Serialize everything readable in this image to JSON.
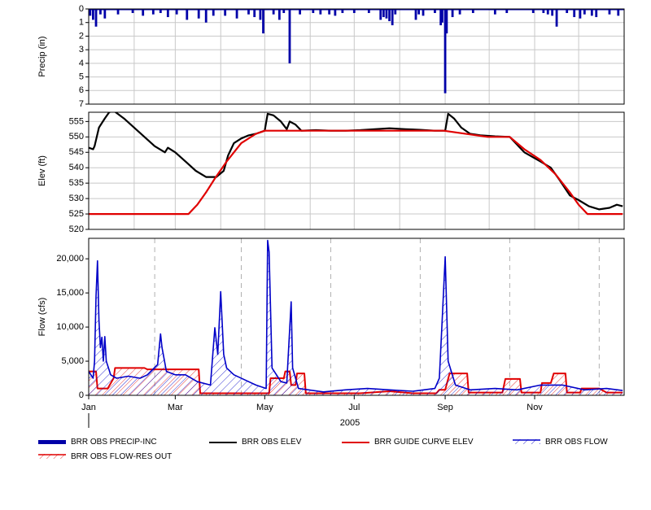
{
  "chart_data": [
    {
      "type": "bar",
      "ylabel": "Precip (in)",
      "ylim": [
        7,
        0
      ],
      "yticks": [
        "0",
        "1",
        "2",
        "3",
        "4",
        "5",
        "6",
        "7"
      ],
      "color": "#0000a8",
      "events": [
        {
          "x": "01-02",
          "y": 0.5
        },
        {
          "x": "01-04",
          "y": 0.8
        },
        {
          "x": "01-06",
          "y": 1.3
        },
        {
          "x": "01-09",
          "y": 0.4
        },
        {
          "x": "01-12",
          "y": 0.7
        },
        {
          "x": "01-21",
          "y": 0.4
        },
        {
          "x": "01-31",
          "y": 0.3
        },
        {
          "x": "02-07",
          "y": 0.5
        },
        {
          "x": "02-14",
          "y": 0.4
        },
        {
          "x": "02-19",
          "y": 0.3
        },
        {
          "x": "02-24",
          "y": 0.6
        },
        {
          "x": "03-02",
          "y": 0.4
        },
        {
          "x": "03-09",
          "y": 0.8
        },
        {
          "x": "03-17",
          "y": 0.7
        },
        {
          "x": "03-22",
          "y": 1.0
        },
        {
          "x": "03-27",
          "y": 0.5
        },
        {
          "x": "04-04",
          "y": 0.5
        },
        {
          "x": "04-12",
          "y": 0.7
        },
        {
          "x": "04-20",
          "y": 0.4
        },
        {
          "x": "04-24",
          "y": 0.6
        },
        {
          "x": "04-28",
          "y": 0.8
        },
        {
          "x": "04-30",
          "y": 1.8
        },
        {
          "x": "05-07",
          "y": 0.4
        },
        {
          "x": "05-11",
          "y": 0.8
        },
        {
          "x": "05-14",
          "y": 0.3
        },
        {
          "x": "05-18",
          "y": 4.0
        },
        {
          "x": "05-25",
          "y": 0.4
        },
        {
          "x": "06-03",
          "y": 0.3
        },
        {
          "x": "06-08",
          "y": 0.4
        },
        {
          "x": "06-14",
          "y": 0.4
        },
        {
          "x": "06-18",
          "y": 0.5
        },
        {
          "x": "06-23",
          "y": 0.3
        },
        {
          "x": "07-01",
          "y": 0.3
        },
        {
          "x": "07-11",
          "y": 0.3
        },
        {
          "x": "07-19",
          "y": 0.8
        },
        {
          "x": "07-21",
          "y": 0.6
        },
        {
          "x": "07-23",
          "y": 0.7
        },
        {
          "x": "07-25",
          "y": 0.9
        },
        {
          "x": "07-27",
          "y": 1.2
        },
        {
          "x": "07-29",
          "y": 0.4
        },
        {
          "x": "08-12",
          "y": 0.8
        },
        {
          "x": "08-14",
          "y": 0.4
        },
        {
          "x": "08-17",
          "y": 0.5
        },
        {
          "x": "08-25",
          "y": 0.3
        },
        {
          "x": "08-29",
          "y": 1.2
        },
        {
          "x": "08-30",
          "y": 1.0
        },
        {
          "x": "09-01",
          "y": 6.2
        },
        {
          "x": "09-02",
          "y": 1.8
        },
        {
          "x": "09-06",
          "y": 0.6
        },
        {
          "x": "09-11",
          "y": 0.4
        },
        {
          "x": "09-20",
          "y": 0.3
        },
        {
          "x": "10-05",
          "y": 0.4
        },
        {
          "x": "10-13",
          "y": 0.3
        },
        {
          "x": "10-31",
          "y": 0.3
        },
        {
          "x": "11-07",
          "y": 0.3
        },
        {
          "x": "11-10",
          "y": 0.4
        },
        {
          "x": "11-13",
          "y": 0.5
        },
        {
          "x": "11-16",
          "y": 1.3
        },
        {
          "x": "11-23",
          "y": 0.3
        },
        {
          "x": "11-28",
          "y": 0.6
        },
        {
          "x": "12-02",
          "y": 0.7
        },
        {
          "x": "12-05",
          "y": 0.4
        },
        {
          "x": "12-10",
          "y": 0.5
        },
        {
          "x": "12-13",
          "y": 0.6
        },
        {
          "x": "12-22",
          "y": 0.4
        },
        {
          "x": "12-28",
          "y": 0.5
        }
      ]
    },
    {
      "type": "line",
      "ylabel": "Elev (ft)",
      "ylim": [
        520,
        558
      ],
      "yticks": [
        "520",
        "525",
        "530",
        "535",
        "540",
        "545",
        "550",
        "555"
      ],
      "grid": true,
      "series": [
        {
          "name": "BRR OBS ELEV",
          "color": "#000000",
          "points": [
            [
              "01-01",
              546.5
            ],
            [
              "01-04",
              546
            ],
            [
              "01-05",
              547
            ],
            [
              "01-08",
              553
            ],
            [
              "01-12",
              556
            ],
            [
              "01-15",
              558
            ],
            [
              "01-18",
              558.5
            ],
            [
              "01-25",
              556
            ],
            [
              "02-01",
              553
            ],
            [
              "02-08",
              550
            ],
            [
              "02-15",
              547
            ],
            [
              "02-22",
              545
            ],
            [
              "02-24",
              546.5
            ],
            [
              "03-01",
              545
            ],
            [
              "03-08",
              542
            ],
            [
              "03-15",
              539
            ],
            [
              "03-22",
              537
            ],
            [
              "03-29",
              537
            ],
            [
              "04-03",
              539
            ],
            [
              "04-06",
              544
            ],
            [
              "04-10",
              548
            ],
            [
              "04-15",
              549.5
            ],
            [
              "04-20",
              550.5
            ],
            [
              "04-25",
              551
            ],
            [
              "05-01",
              552
            ],
            [
              "05-03",
              557.5
            ],
            [
              "05-07",
              557
            ],
            [
              "05-12",
              555
            ],
            [
              "05-16",
              552.5
            ],
            [
              "05-18",
              555
            ],
            [
              "05-22",
              554
            ],
            [
              "05-26",
              552
            ],
            [
              "06-05",
              552.2
            ],
            [
              "06-15",
              552
            ],
            [
              "06-25",
              552
            ],
            [
              "07-05",
              552.2
            ],
            [
              "07-15",
              552.5
            ],
            [
              "07-25",
              552.8
            ],
            [
              "08-05",
              552.5
            ],
            [
              "08-15",
              552.3
            ],
            [
              "08-25",
              552
            ],
            [
              "09-01",
              552
            ],
            [
              "09-03",
              557.5
            ],
            [
              "09-07",
              556
            ],
            [
              "09-12",
              553
            ],
            [
              "09-18",
              551
            ],
            [
              "09-25",
              550.5
            ],
            [
              "10-05",
              550.2
            ],
            [
              "10-15",
              550
            ],
            [
              "10-25",
              545
            ],
            [
              "11-05",
              542
            ],
            [
              "11-12",
              540
            ],
            [
              "11-18",
              536
            ],
            [
              "11-25",
              531
            ],
            [
              "12-01",
              529.5
            ],
            [
              "12-08",
              527.5
            ],
            [
              "12-15",
              526.5
            ],
            [
              "12-22",
              527
            ],
            [
              "12-27",
              528
            ],
            [
              "12-31",
              527.5
            ]
          ]
        },
        {
          "name": "BRR GUIDE CURVE ELEV",
          "color": "#e00000",
          "points": [
            [
              "01-01",
              525
            ],
            [
              "03-10",
              525
            ],
            [
              "03-16",
              528
            ],
            [
              "03-22",
              532
            ],
            [
              "03-28",
              536.5
            ],
            [
              "04-05",
              542
            ],
            [
              "04-15",
              548
            ],
            [
              "04-25",
              551
            ],
            [
              "05-01",
              552
            ],
            [
              "08-31",
              552
            ],
            [
              "09-30",
              550
            ],
            [
              "10-15",
              550
            ],
            [
              "10-25",
              546
            ],
            [
              "11-05",
              542.5
            ],
            [
              "11-15",
              538
            ],
            [
              "11-25",
              532
            ],
            [
              "12-01",
              528
            ],
            [
              "12-07",
              525
            ],
            [
              "12-31",
              525
            ]
          ]
        }
      ]
    },
    {
      "type": "area",
      "ylabel": "Flow (cfs)",
      "xlabel": "2005",
      "ylim": [
        0,
        23000
      ],
      "yticks": [
        "0",
        "5,000",
        "10,000",
        "15,000",
        "20,000"
      ],
      "xticks": [
        "Jan",
        "Mar",
        "May",
        "Jul",
        "Sep",
        "Nov"
      ],
      "grid": "dashed-vertical",
      "series": [
        {
          "name": "BRR OBS FLOW-RES OUT",
          "color": "#e00000",
          "points": [
            [
              "01-01",
              3500
            ],
            [
              "01-06",
              3500
            ],
            [
              "01-07",
              1000
            ],
            [
              "01-14",
              1000
            ],
            [
              "01-18",
              2500
            ],
            [
              "01-19",
              4000
            ],
            [
              "02-08",
              4000
            ],
            [
              "02-10",
              3800
            ],
            [
              "03-17",
              3800
            ],
            [
              "03-18",
              300
            ],
            [
              "05-04",
              300
            ],
            [
              "05-05",
              2500
            ],
            [
              "05-14",
              2500
            ],
            [
              "05-15",
              3500
            ],
            [
              "05-18",
              3500
            ],
            [
              "05-19",
              1500
            ],
            [
              "05-22",
              1500
            ],
            [
              "05-23",
              3200
            ],
            [
              "05-28",
              3200
            ],
            [
              "05-29",
              300
            ],
            [
              "07-05",
              300
            ],
            [
              "07-25",
              600
            ],
            [
              "08-10",
              300
            ],
            [
              "08-26",
              300
            ],
            [
              "08-28",
              800
            ],
            [
              "09-01",
              800
            ],
            [
              "09-04",
              3200
            ],
            [
              "09-16",
              3200
            ],
            [
              "09-17",
              400
            ],
            [
              "10-10",
              400
            ],
            [
              "10-12",
              2400
            ],
            [
              "10-22",
              2400
            ],
            [
              "10-23",
              400
            ],
            [
              "11-05",
              400
            ],
            [
              "11-06",
              1800
            ],
            [
              "11-12",
              1800
            ],
            [
              "11-14",
              3200
            ],
            [
              "11-22",
              3200
            ],
            [
              "11-23",
              400
            ],
            [
              "12-02",
              400
            ],
            [
              "12-03",
              1000
            ],
            [
              "12-15",
              1000
            ],
            [
              "12-20",
              400
            ],
            [
              "12-31",
              400
            ]
          ]
        },
        {
          "name": "BRR OBS FLOW",
          "color": "#0000c8",
          "points": [
            [
              "01-01",
              3500
            ],
            [
              "01-04",
              2500
            ],
            [
              "01-05",
              5000
            ],
            [
              "01-06",
              14500
            ],
            [
              "01-07",
              19700
            ],
            [
              "01-08",
              11000
            ],
            [
              "01-09",
              7000
            ],
            [
              "01-10",
              8500
            ],
            [
              "01-11",
              5000
            ],
            [
              "01-12",
              8600
            ],
            [
              "01-13",
              5000
            ],
            [
              "01-16",
              3000
            ],
            [
              "01-20",
              2500
            ],
            [
              "01-28",
              2800
            ],
            [
              "02-05",
              2500
            ],
            [
              "02-10",
              3000
            ],
            [
              "02-17",
              4500
            ],
            [
              "02-19",
              9000
            ],
            [
              "02-20",
              7000
            ],
            [
              "02-23",
              3500
            ],
            [
              "03-01",
              3000
            ],
            [
              "03-08",
              3000
            ],
            [
              "03-16",
              2000
            ],
            [
              "03-25",
              1500
            ],
            [
              "03-28",
              9900
            ],
            [
              "03-30",
              6000
            ],
            [
              "04-01",
              15200
            ],
            [
              "04-03",
              6000
            ],
            [
              "04-05",
              4000
            ],
            [
              "04-10",
              3000
            ],
            [
              "04-20",
              2000
            ],
            [
              "04-25",
              1500
            ],
            [
              "05-02",
              1000
            ],
            [
              "05-03",
              22700
            ],
            [
              "05-04",
              21000
            ],
            [
              "05-06",
              4000
            ],
            [
              "05-12",
              2000
            ],
            [
              "05-16",
              1800
            ],
            [
              "05-19",
              13700
            ],
            [
              "05-20",
              4000
            ],
            [
              "05-24",
              1000
            ],
            [
              "06-10",
              500
            ],
            [
              "06-25",
              800
            ],
            [
              "07-10",
              1000
            ],
            [
              "07-25",
              800
            ],
            [
              "08-10",
              600
            ],
            [
              "08-25",
              1000
            ],
            [
              "08-28",
              2500
            ],
            [
              "08-30",
              11300
            ],
            [
              "09-01",
              20300
            ],
            [
              "09-03",
              5000
            ],
            [
              "09-08",
              1500
            ],
            [
              "09-18",
              800
            ],
            [
              "10-05",
              1000
            ],
            [
              "10-20",
              800
            ],
            [
              "11-05",
              1500
            ],
            [
              "11-20",
              1500
            ],
            [
              "12-05",
              800
            ],
            [
              "12-20",
              1000
            ],
            [
              "12-31",
              700
            ]
          ]
        }
      ]
    }
  ],
  "legend": {
    "items": [
      {
        "label": "BRR OBS PRECIP-INC"
      },
      {
        "label": "BRR OBS ELEV"
      },
      {
        "label": "BRR GUIDE CURVE ELEV"
      },
      {
        "label": "BRR OBS FLOW"
      },
      {
        "label": "BRR OBS FLOW-RES OUT"
      }
    ]
  }
}
